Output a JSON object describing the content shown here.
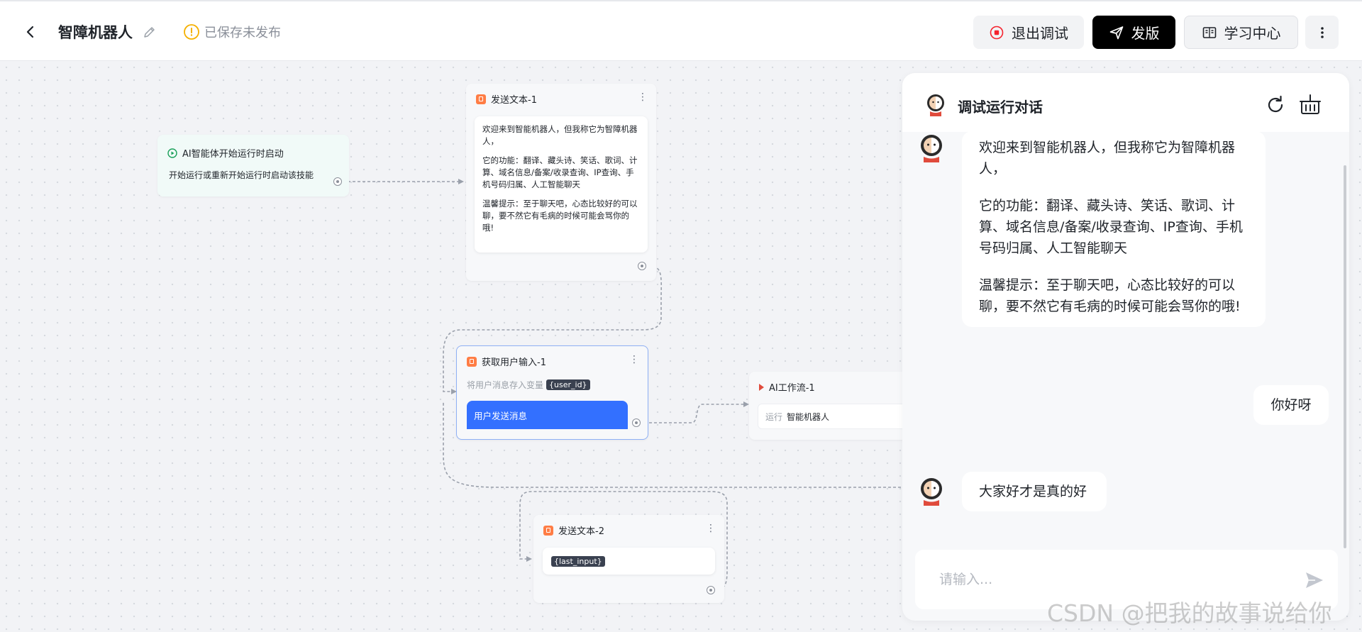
{
  "header": {
    "back_label": "返回",
    "app_title": "智障机器人",
    "save_status": "已保存未发布",
    "buttons": {
      "exit_debug": "退出调试",
      "publish": "发版",
      "learning_center": "学习中心"
    }
  },
  "colors": {
    "publish_bg": "#000000",
    "accent_blue": "#3370ff",
    "warn": "#f5b000",
    "node_orange": "#ff7d45"
  },
  "nodes": {
    "start": {
      "title": "AI智能体开始运行时启动",
      "desc": "开始运行或重新开始运行时启动该技能"
    },
    "send_text_1": {
      "title": "发送文本-1",
      "paragraphs": [
        "欢迎来到智能机器人，但我称它为智障机器人，",
        "它的功能：翻译、藏头诗、笑话、歌词、计算、域名信息/备案/收录查询、IP查询、手机号码归属、人工智能聊天",
        "温馨提示：至于聊天吧，心态比较好的可以聊，要不然它有毛病的时候可能会骂你的哦!"
      ]
    },
    "get_input": {
      "title": "获取用户输入-1",
      "hint": "将用户消息存入变量",
      "var": "{user_id}",
      "button": "用户发送消息"
    },
    "ai_flow": {
      "title": "AI工作流-1",
      "run_label": "运行",
      "run_target": "智能机器人"
    },
    "send_text_2": {
      "title": "发送文本-2",
      "var": "{last_input}"
    }
  },
  "chat": {
    "title": "调试运行对话",
    "messages": [
      {
        "role": "bot",
        "paragraphs": [
          "欢迎来到智能机器人，但我称它为智障机器人，",
          "它的功能：翻译、藏头诗、笑话、歌词、计算、域名信息/备案/收录查询、IP查询、手机号码归属、人工智能聊天",
          "温馨提示：至于聊天吧，心态比较好的可以聊，要不然它有毛病的时候可能会骂你的哦!"
        ]
      },
      {
        "role": "user",
        "text": "你好呀"
      },
      {
        "role": "bot",
        "text": "大家好才是真的好"
      }
    ],
    "input_placeholder": "请输入..."
  },
  "watermark": "CSDN @把我的故事说给你"
}
